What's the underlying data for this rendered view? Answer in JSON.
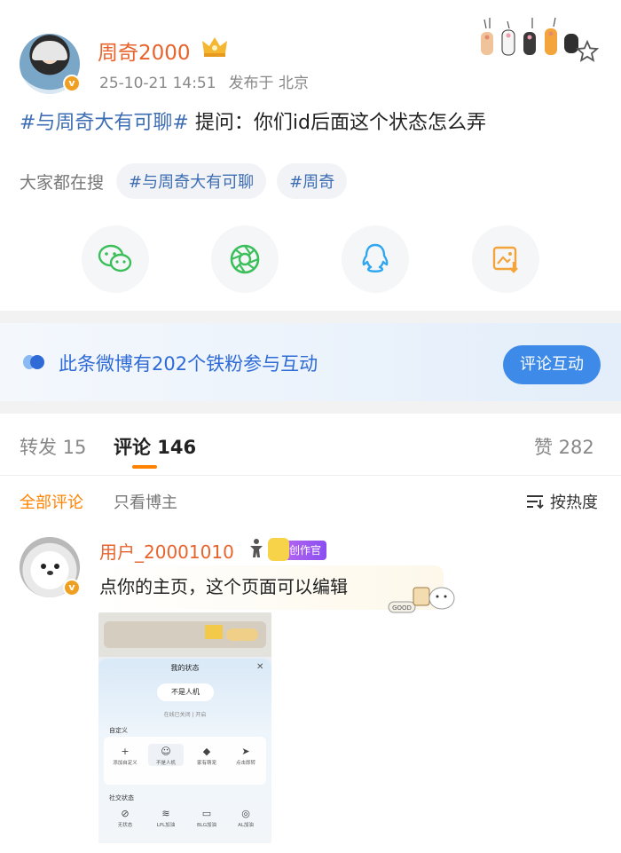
{
  "post": {
    "author": "周奇2000",
    "timestamp": "25-10-21 14:51",
    "location": "发布于 北京",
    "hashtag": "#与周奇大有可聊#",
    "text": " 提问：你们id后面这个状态怎么弄"
  },
  "search": {
    "label": "大家都在搜",
    "chips": [
      "#与周奇大有可聊",
      "#周奇"
    ]
  },
  "share": {
    "items": [
      "wechat-icon",
      "moments-icon",
      "qq-icon",
      "save-image-icon"
    ]
  },
  "fans": {
    "text": "此条微博有202个铁粉参与互动",
    "button": "评论互动"
  },
  "tabs": {
    "repost": "转发 15",
    "comments": "评论 146",
    "likes": "赞 282"
  },
  "filters": {
    "all": "全部评论",
    "author_only": "只看博主",
    "sort": "按热度"
  },
  "comment": {
    "user": "用户_20001010",
    "badge": "创作官",
    "text": "点你的主页，这个页面可以编辑",
    "sticker": "GOOD"
  },
  "embed": {
    "title": "我的状态",
    "state": "不是人机",
    "hint": "在线已关闭 | 开启",
    "custom_section": "自定义",
    "options": [
      "添加自定义",
      "不是人机",
      "家有萌宠",
      "点击即转"
    ],
    "social_section": "社交状态",
    "social": [
      "无状态",
      "LPL加油",
      "BLG加油",
      "AL加油"
    ]
  },
  "colors": {
    "author": "#e8632b",
    "hashtag": "#3d6db3",
    "accent": "#ff8200",
    "fans_button": "#3d8ae8"
  }
}
